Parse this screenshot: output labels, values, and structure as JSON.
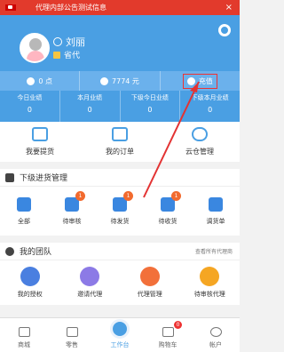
{
  "notice": {
    "text": "代理内部公告测试信息"
  },
  "user": {
    "name": "刘丽",
    "role": "省代"
  },
  "points_bar": {
    "points": "0 点",
    "balance": "7774 元",
    "recharge_label": "充值"
  },
  "stats": [
    {
      "label": "今日业绩",
      "value": "0"
    },
    {
      "label": "本月业绩",
      "value": "0"
    },
    {
      "label": "下级今日业绩",
      "value": "0"
    },
    {
      "label": "下级本月业绩",
      "value": "0"
    }
  ],
  "quick": [
    {
      "label": "我要提货"
    },
    {
      "label": "我的订单"
    },
    {
      "label": "云仓管理"
    }
  ],
  "purchase": {
    "title": "下级进货管理",
    "items": [
      {
        "label": "全部",
        "badge": ""
      },
      {
        "label": "待审核",
        "badge": "1"
      },
      {
        "label": "待发货",
        "badge": "1"
      },
      {
        "label": "待收货",
        "badge": "1"
      },
      {
        "label": "调货单",
        "badge": ""
      }
    ]
  },
  "team": {
    "title": "我的团队",
    "link": "查看所有代理商",
    "items": [
      {
        "label": "我的授权"
      },
      {
        "label": "邀请代理"
      },
      {
        "label": "代理管理"
      },
      {
        "label": "待审核代理"
      }
    ]
  },
  "tabbar": {
    "items": [
      {
        "label": "商城"
      },
      {
        "label": "零售"
      },
      {
        "label": "工作台"
      },
      {
        "label": "购物车",
        "badge": "0"
      },
      {
        "label": "帐户"
      }
    ]
  },
  "colors": {
    "brand": "#4a9fe3",
    "notice": "#e23a2c",
    "badge": "#f26a2e",
    "highlight": "#e33333"
  }
}
